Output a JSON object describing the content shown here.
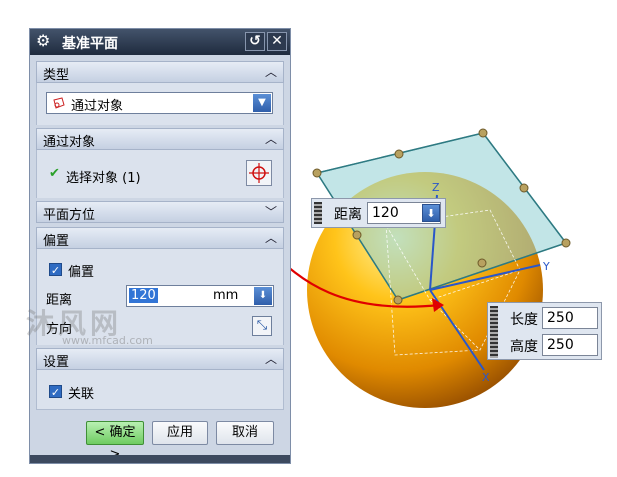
{
  "dialog": {
    "title": "基准平面",
    "sections": {
      "type": "类型",
      "through_object": "通过对象",
      "plane_orientation": "平面方位",
      "offset": "偏置",
      "settings": "设置"
    },
    "type_value": "通过对象",
    "select_object_label": "选择对象 (1)",
    "offset_checkbox_label": "偏置",
    "distance_label": "距离",
    "distance_value": "120",
    "distance_unit": "mm",
    "direction_label": "方向",
    "associative_label": "关联",
    "buttons": {
      "ok": "< 确定 >",
      "apply": "应用",
      "cancel": "取消"
    }
  },
  "handles": {
    "distance_label": "距离",
    "distance_value": "120",
    "length_label": "长度",
    "length_value": "250",
    "height_label": "高度",
    "height_value": "250"
  },
  "axes": {
    "z": "Z",
    "y": "Y",
    "x": "X"
  },
  "watermark": {
    "main": "沐风网",
    "url": "www.mfcad.com"
  },
  "colors": {
    "sphere": "#f2a100",
    "plane": "#7fc4c8",
    "annotation": "#e00000",
    "title_bar": "#2a3850"
  }
}
